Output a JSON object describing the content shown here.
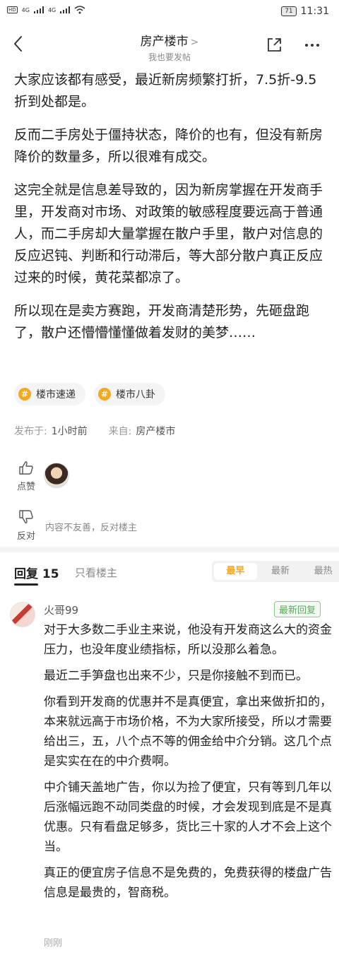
{
  "status_bar": {
    "hd1": "HD",
    "hd2": "HD",
    "net1": "4G",
    "net2": "4G",
    "battery": "71",
    "time": "11:31"
  },
  "nav": {
    "title": "房产楼市",
    "title_chevron": ">",
    "subtitle": "我也要发帖"
  },
  "article": {
    "paragraphs": [
      "大家应该都有感受，最近新房频繁打折，7.5折-9.5折到处都是。",
      "反而二手房处于僵持状态，降价的也有，但没有新房降价的数量多，所以很难有成交。",
      "这完全就是信息差导致的，因为新房掌握在开发商手里，开发商对市场、对政策的敏感程度要远高于普通人，而二手房却大量掌握在散户手里，散户对信息的反应迟钝、判断和行动滞后，等大部分散户真正反应过来的时候，黄花菜都凉了。",
      "所以现在是卖方赛跑，开发商清楚形势，先砸盘跑了，散户还懵懵懂懂做着发财的美梦……"
    ],
    "tags": [
      "楼市速递",
      "楼市八卦"
    ],
    "tag_symbol": "#",
    "meta": {
      "posted_label": "发布于:",
      "posted_value": "1小时前",
      "source_label": "来自:",
      "source_value": "房产楼市"
    },
    "like_label": "点赞",
    "dislike_label": "反对",
    "dislike_note": "内容不友善，反对楼主"
  },
  "replies_header": {
    "label": "回复",
    "count": "15",
    "only_op": "只看楼主",
    "sort_options": [
      "最早",
      "最新",
      "最热"
    ],
    "active_sort": "最早"
  },
  "reply": {
    "name": "火哥99",
    "badge": "最新回复",
    "paragraphs": [
      "对于大多数二手业主来说，他没有开发商这么大的资金压力，也没年度业绩指标，所以没那么着急。",
      "最近二手笋盘也出来不少，只是你接触不到而已。",
      "你看到开发商的优惠并不是真便宜，拿出来做折扣的，本来就远高于市场价格，不为大家所接受，所以才需要给出三，五，八个点不等的佣金给中介分销。这几个点是实实在在的中介费啊。",
      "中介铺天盖地广告，你以为捡了便宜，只有等到几年以后涨幅远跑不动同类盘的时候，才会发现到底是不是真优惠。只有看盘足够多，货比三十家的人才不会上这个当。",
      "真正的便宜房子信息不是免费的，免费获得的楼盘广告信息是最贵的，智商税。"
    ],
    "time": "刚刚"
  },
  "colors": {
    "accent": "#f5a623",
    "badge_green": "#58a65a"
  }
}
